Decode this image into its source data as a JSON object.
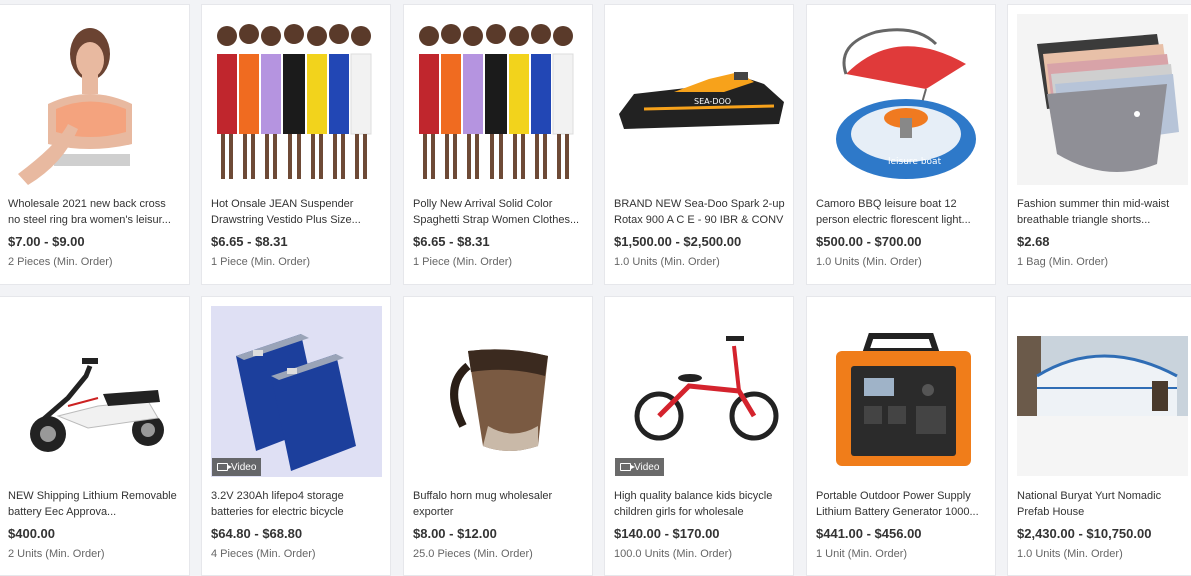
{
  "products": [
    {
      "title": "Wholesale 2021 new back cross no steel ring bra women's leisur...",
      "price": "$7.00 - $9.00",
      "order": "2 Pieces (Min. Order)",
      "icon": "sports-bra-image"
    },
    {
      "title": "Hot Onsale JEAN Suspender Drawstring Vestido Plus Size...",
      "price": "$6.65 - $8.31",
      "order": "1 Piece (Min. Order)",
      "icon": "dresses-image"
    },
    {
      "title": "Polly New Arrival Solid Color Spaghetti Strap Women Clothes...",
      "price": "$6.65 - $8.31",
      "order": "1 Piece (Min. Order)",
      "icon": "dresses-image"
    },
    {
      "title": "BRAND NEW Sea-Doo Spark 2-up Rotax 900 A C E - 90 IBR & CONV",
      "price": "$1,500.00 - $2,500.00",
      "order": "1.0 Units (Min. Order)",
      "icon": "jet-ski-image"
    },
    {
      "title": "Camoro BBQ leisure boat 12 person electric florescent light...",
      "price": "$500.00 - $700.00",
      "order": "1.0 Units (Min. Order)",
      "icon": "bbq-boat-image"
    },
    {
      "title": "Fashion summer thin mid-waist breathable triangle shorts...",
      "price": "$2.68",
      "order": "1 Bag (Min. Order)",
      "icon": "underwear-image"
    },
    {
      "title": "NEW Shipping Lithium Removable battery Eec Approva...",
      "price": "$400.00",
      "order": "2 Units (Min. Order)",
      "icon": "scooter-image"
    },
    {
      "title": "3.2V 230Ah lifepo4 storage batteries for electric bicycle",
      "price": "$64.80 - $68.80",
      "order": "4 Pieces (Min. Order)",
      "icon": "battery-cells-image",
      "video": "Video"
    },
    {
      "title": "Buffalo horn mug wholesaler exporter",
      "price": "$8.00 - $12.00",
      "order": "25.0 Pieces (Min. Order)",
      "icon": "horn-mug-image"
    },
    {
      "title": "High quality balance kids bicycle children girls for wholesale",
      "price": "$140.00 - $170.00",
      "order": "100.0 Units (Min. Order)",
      "icon": "balance-bike-image",
      "video": "Video"
    },
    {
      "title": "Portable Outdoor Power Supply Lithium Battery Generator 1000...",
      "price": "$441.00 - $456.00",
      "order": "1 Unit (Min. Order)",
      "icon": "power-station-image"
    },
    {
      "title": "National Buryat Yurt Nomadic Prefab House",
      "price": "$2,430.00 - $10,750.00",
      "order": "1.0 Units (Min. Order)",
      "icon": "yurt-image"
    }
  ]
}
